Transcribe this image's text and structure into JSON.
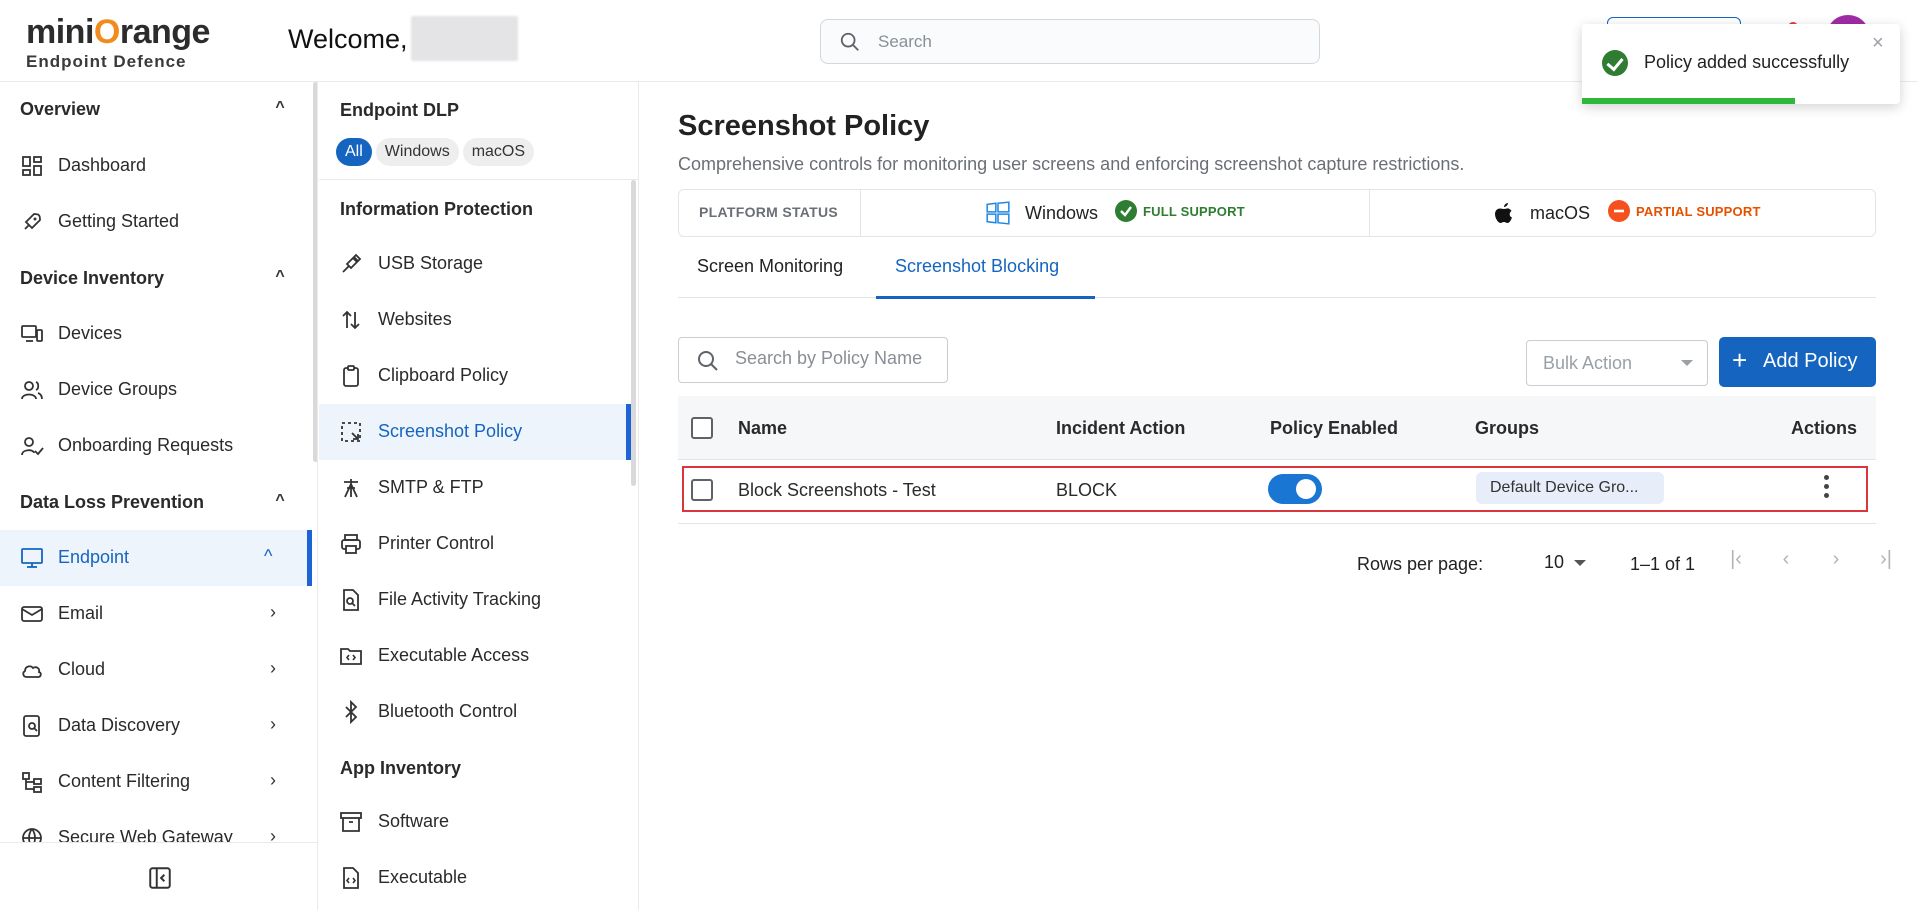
{
  "header": {
    "logo_text_1": "mini",
    "logo_text_o": "O",
    "logo_text_2": "range",
    "logo_sub": "Endpoint Defence",
    "welcome": "Welcome,",
    "search_placeholder": "Search"
  },
  "toast": {
    "message": "Policy added successfully",
    "close": "×",
    "progress": 0.67
  },
  "sidebar": {
    "sections": [
      {
        "label": "Overview",
        "chevron": "⌃"
      },
      {
        "label": "Device Inventory",
        "chevron": "⌃"
      },
      {
        "label": "Data Loss Prevention",
        "chevron": "⌃"
      }
    ],
    "items": [
      {
        "label": "Dashboard",
        "icon": "dashboard-icon"
      },
      {
        "label": "Getting Started",
        "icon": "rocket-icon"
      },
      {
        "label": "Devices",
        "icon": "devices-icon"
      },
      {
        "label": "Device Groups",
        "icon": "users-icon"
      },
      {
        "label": "Onboarding Requests",
        "icon": "user-check-icon"
      },
      {
        "label": "Endpoint",
        "icon": "monitor-icon",
        "chevron": "⌃"
      },
      {
        "label": "Email",
        "icon": "mail-icon",
        "chevron": "›"
      },
      {
        "label": "Cloud",
        "icon": "cloud-icon",
        "chevron": "›"
      },
      {
        "label": "Data Discovery",
        "icon": "discovery-icon",
        "chevron": "›"
      },
      {
        "label": "Content Filtering",
        "icon": "filter-icon",
        "chevron": "›"
      },
      {
        "label": "Secure Web Gateway",
        "icon": "globe-icon",
        "chevron": "›"
      }
    ]
  },
  "panel2": {
    "title": "Endpoint DLP",
    "chips": [
      "All",
      "Windows",
      "macOS"
    ],
    "sections": [
      "Information Protection",
      "App Inventory"
    ],
    "items": [
      {
        "label": "USB Storage",
        "icon": "usb-icon"
      },
      {
        "label": "Websites",
        "icon": "arrows-icon"
      },
      {
        "label": "Clipboard Policy",
        "icon": "clipboard-icon"
      },
      {
        "label": "Screenshot Policy",
        "icon": "screenshot-icon"
      },
      {
        "label": "SMTP & FTP",
        "icon": "tower-icon"
      },
      {
        "label": "Printer Control",
        "icon": "printer-icon"
      },
      {
        "label": "File Activity Tracking",
        "icon": "file-search-icon"
      },
      {
        "label": "Executable Access",
        "icon": "folder-code-icon"
      },
      {
        "label": "Bluetooth Control",
        "icon": "bluetooth-icon"
      },
      {
        "label": "Software",
        "icon": "archive-icon"
      },
      {
        "label": "Executable",
        "icon": "file-code-icon"
      }
    ]
  },
  "main": {
    "title": "Screenshot Policy",
    "description": "Comprehensive controls for monitoring user screens and enforcing screenshot capture restrictions.",
    "platform": {
      "label": "PLATFORM STATUS",
      "windows": {
        "name": "Windows",
        "badge": "FULL SUPPORT",
        "color": "#2e7d32"
      },
      "macos": {
        "name": "macOS",
        "badge": "PARTIAL SUPPORT",
        "color": "#e65100"
      }
    },
    "tabs": [
      "Screen Monitoring",
      "Screenshot Blocking"
    ],
    "search_placeholder": "Search by Policy Name",
    "bulk_action": "Bulk Action",
    "add_button": "Add Policy",
    "table": {
      "headers": [
        "Name",
        "Incident Action",
        "Policy Enabled",
        "Groups",
        "Actions"
      ],
      "rows": [
        {
          "name": "Block Screenshots - Test",
          "action": "BLOCK",
          "enabled": true,
          "groups": "Default Device Gro..."
        }
      ]
    },
    "pager": {
      "rows_label": "Rows per page:",
      "rows_value": "10",
      "range": "1–1 of 1"
    }
  },
  "colors": {
    "accent": "#1565c0",
    "toast_progress": "#2fb93a",
    "highlight": "#d9363e"
  }
}
